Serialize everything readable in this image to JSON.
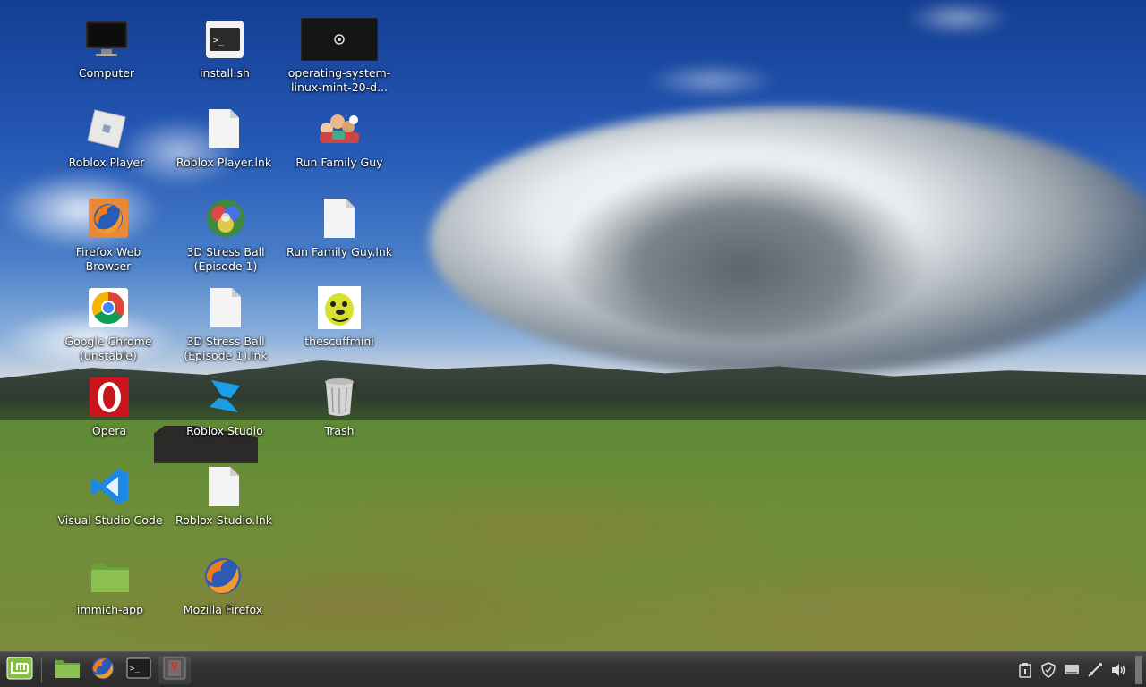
{
  "desktop": {
    "icons": [
      {
        "name": "computer",
        "label": "Computer"
      },
      {
        "name": "install-sh",
        "label": "install.sh"
      },
      {
        "name": "operating-system-video",
        "label": "operating-system-linux-mint-20-d..."
      },
      {
        "name": "roblox-player",
        "label": "Roblox Player"
      },
      {
        "name": "roblox-player-lnk",
        "label": "Roblox Player.lnk"
      },
      {
        "name": "run-family-guy",
        "label": "Run Family Guy"
      },
      {
        "name": "firefox-web-browser",
        "label": "Firefox Web Browser"
      },
      {
        "name": "3d-stress-ball",
        "label": "3D Stress Ball (Episode 1)"
      },
      {
        "name": "run-family-guy-lnk",
        "label": "Run Family Guy.lnk"
      },
      {
        "name": "google-chrome",
        "label": "Google Chrome (unstable)"
      },
      {
        "name": "3d-stress-ball-lnk",
        "label": "3D Stress Ball (Episode 1).lnk"
      },
      {
        "name": "thescuffmini",
        "label": "thescuffmini"
      },
      {
        "name": "opera",
        "label": "Opera"
      },
      {
        "name": "roblox-studio",
        "label": "Roblox Studio"
      },
      {
        "name": "trash",
        "label": "Trash"
      },
      {
        "name": "visual-studio-code",
        "label": "Visual Studio Code"
      },
      {
        "name": "roblox-studio-lnk",
        "label": "Roblox Studio.lnk"
      },
      {
        "name": "immich-app",
        "label": "immich-app"
      },
      {
        "name": "mozilla-firefox",
        "label": "Mozilla Firefox"
      }
    ]
  },
  "taskbar": {
    "launchers": [
      "mint-menu-icon",
      "files-icon",
      "firefox-icon",
      "terminal-icon",
      "app-icon"
    ],
    "tray": [
      "clipboard-icon",
      "shield-icon",
      "display-icon",
      "network-icon",
      "volume-icon"
    ]
  },
  "colors": {
    "taskbar_bg": "#2b2b2b",
    "mint_green": "#86be43",
    "label_text": "#ffffff"
  }
}
